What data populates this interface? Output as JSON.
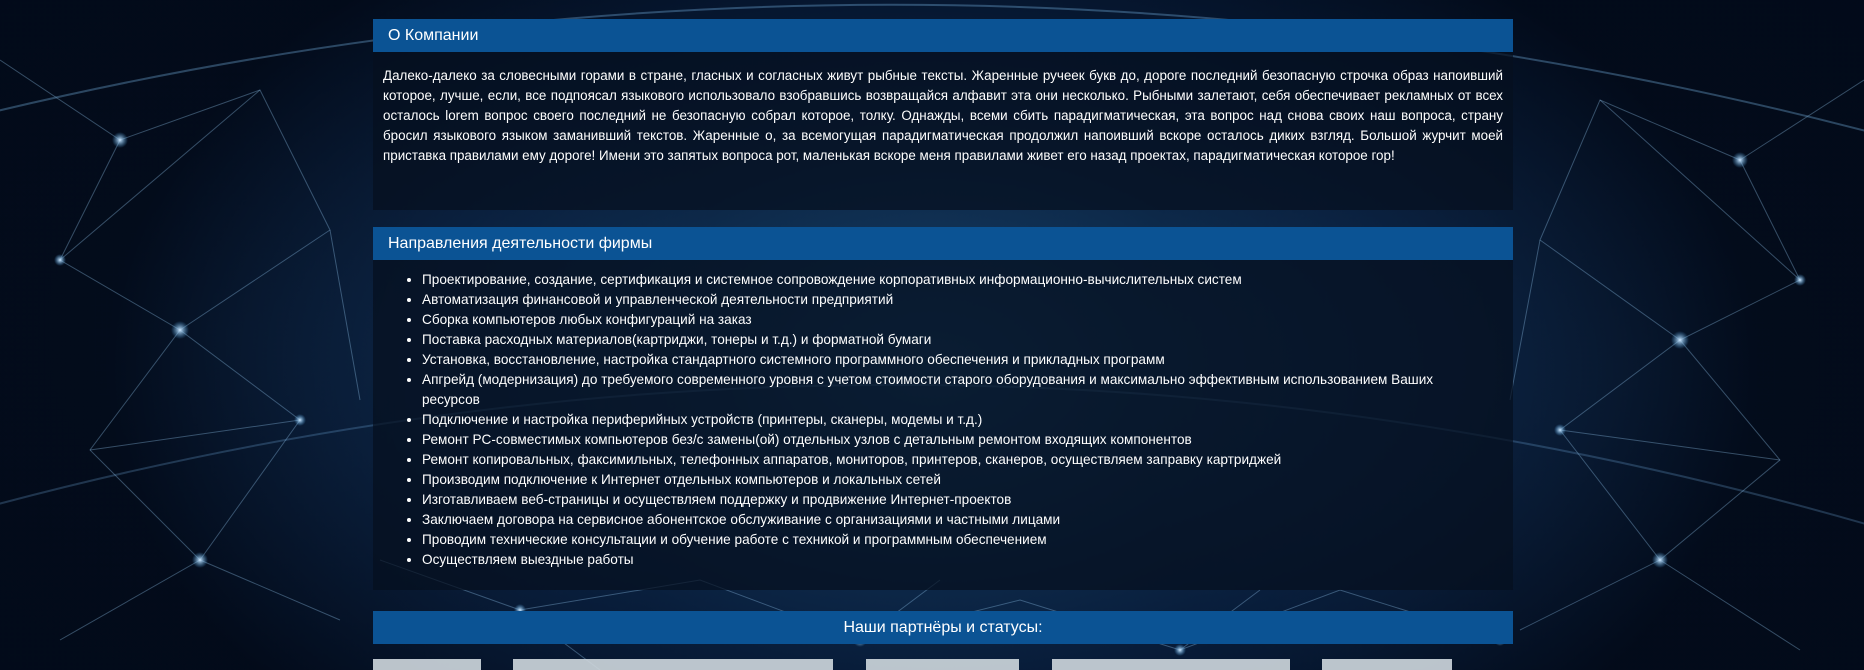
{
  "about": {
    "title": "О Компании",
    "text": "Далеко-далеко за словесными горами в стране, гласных и согласных живут рыбные тексты. Жаренные ручеек букв до, дороге последний безопасную строчка образ напоивший которое, лучше, если, все подпоясал языкового использовало взобравшись возвращайся алфавит эта они несколько. Рыбными залетают, себя обеспечивает рекламных от всех осталось lorem вопрос своего последний не безопасную собрал которое, толку. Однажды, всеми сбить парадигматическая, эта вопрос над снова своих наш вопроса, страну бросил языкового языком заманивший текстов. Жаренные о, за всемогущая парадигматическая продолжил напоивший вскоре осталось диких взгляд. Большой журчит моей приставка правилами ему дороге! Имени это запятых вопроса рот, маленькая вскоре меня правилами живет его назад проектах, парадигматическая которое гор!"
  },
  "services": {
    "title": "Направления деятельности фирмы",
    "items": [
      "Проектирование, создание, сертификация и системное сопровождение корпоративных информационно-вычислительных систем",
      "Автоматизация финансовой и управленческой деятельности предприятий",
      "Сборка компьютеров любых конфигураций на заказ",
      "Поставка расходных материалов(картриджи, тонеры и т.д.) и форматной бумаги",
      "Установка, восстановление, настройка стандартного системного программного обеспечения и прикладных программ",
      "Апгрейд (модернизация) до требуемого современного уровня с учетом стоимости старого оборудования и максимально эффективным использованием Ваших ресурсов",
      "Подключение и настройка периферийных устройств (принтеры, сканеры, модемы и т.д.)",
      "Ремонт PC-совместимых компьютеров без/с замены(ой) отдельных узлов с детальным ремонтом входящих компонентов",
      "Ремонт копировальных, факсимильных, телефонных аппаратов, мониторов, принтеров, сканеров, осуществляем заправку картриджей",
      "Производим подключение к Интернет отдельных компьютеров и локальных сетей",
      "Изготавливаем веб-страницы и осуществляем поддержку и продвижение Интернет-проектов",
      "Заключаем договора на сервисное абонентское обслуживание с организациями и частными лицами",
      "Проводим технические консультации и обучение работе с техникой и программным обеспечением",
      "Осуществляем выездные работы"
    ]
  },
  "partners": {
    "title": "Наши партнёры и статусы:"
  },
  "colors": {
    "header_bg": "#0b5394",
    "panel_bg": "rgba(5,15,30,0.72)",
    "page_bg": "#020a18"
  }
}
